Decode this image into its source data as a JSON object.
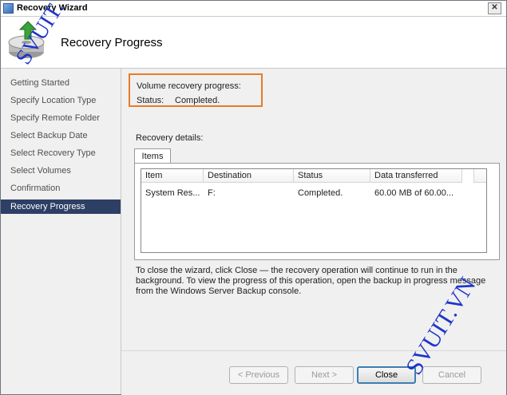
{
  "window": {
    "title": "Recovery Wizard",
    "close_symbol": "✕"
  },
  "header": {
    "title": "Recovery Progress"
  },
  "steps": [
    {
      "label": "Getting Started"
    },
    {
      "label": "Specify Location Type"
    },
    {
      "label": "Specify Remote Folder"
    },
    {
      "label": "Select Backup Date"
    },
    {
      "label": "Select Recovery Type"
    },
    {
      "label": "Select Volumes"
    },
    {
      "label": "Confirmation"
    },
    {
      "label": "Recovery Progress",
      "active": true
    }
  ],
  "progress": {
    "heading": "Volume recovery progress:",
    "status_label": "Status:",
    "status_value": "Completed."
  },
  "details": {
    "heading": "Recovery details:",
    "tab_label": "Items",
    "columns": [
      "Item",
      "Destination",
      "Status",
      "Data transferred"
    ],
    "rows": [
      {
        "item": "System Res...",
        "destination": "F:",
        "status": "Completed.",
        "data": "60.00 MB of 60.00..."
      }
    ]
  },
  "info_text": "To close the wizard, click Close — the recovery operation will continue to run in the background. To view the progress of this operation, open the backup in progress message from the Windows Server Backup console.",
  "buttons": {
    "previous": "< Previous",
    "next": "Next >",
    "close": "Close",
    "cancel": "Cancel"
  },
  "watermarks": [
    "SVUIT.VN",
    "SVUIT.VN"
  ],
  "colors": {
    "highlight_box": "#e87b2a",
    "active_step_bg": "#2e3f66",
    "watermark": "#1f35c9"
  }
}
